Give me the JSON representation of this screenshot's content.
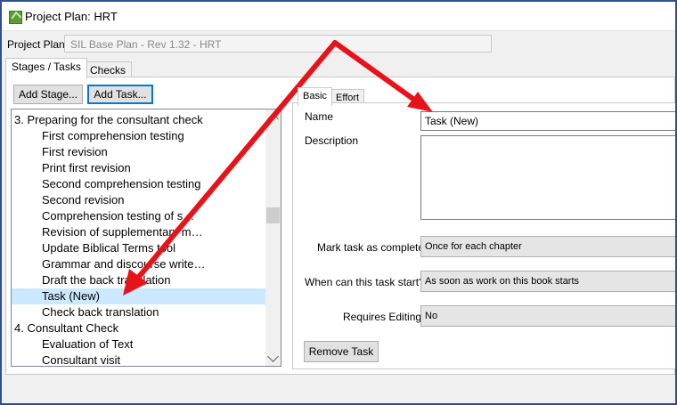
{
  "window": {
    "title": "Project Plan: HRT"
  },
  "project_plan": {
    "label": "Project Plan:",
    "value": "SIL Base Plan - Rev 1.32 - HRT"
  },
  "tabs": [
    {
      "label": "Stages / Tasks"
    },
    {
      "label": "Checks"
    }
  ],
  "toolbar": {
    "add_stage": "Add Stage...",
    "add_task": "Add Task..."
  },
  "tree": {
    "rows": [
      {
        "label": "3. Preparing for the consultant check",
        "level": 0
      },
      {
        "label": "First comprehension testing",
        "level": 1
      },
      {
        "label": "First revision",
        "level": 1
      },
      {
        "label": "Print first revision",
        "level": 1
      },
      {
        "label": "Second comprehension testing",
        "level": 1
      },
      {
        "label": "Second revision",
        "level": 1
      },
      {
        "label": "Comprehension testing of s…",
        "level": 1
      },
      {
        "label": "Revision of supplementary m…",
        "level": 1
      },
      {
        "label": "Update Biblical Terms tool",
        "level": 1
      },
      {
        "label": "Grammar and discourse write…",
        "level": 1
      },
      {
        "label": "Draft the back translation",
        "level": 1
      },
      {
        "label": "Task (New)",
        "level": 1,
        "selected": true
      },
      {
        "label": "Check back translation",
        "level": 1
      },
      {
        "label": "4. Consultant Check",
        "level": 0
      },
      {
        "label": "Evaluation of Text",
        "level": 1
      },
      {
        "label": "Consultant visit",
        "level": 1
      }
    ]
  },
  "detail": {
    "tabs": [
      {
        "label": "Basic"
      },
      {
        "label": "Effort"
      }
    ],
    "name_label": "Name",
    "name_value": "Task (New)",
    "description_label": "Description",
    "description_value": "",
    "mark_complete_label": "Mark task as complete",
    "mark_complete_value": "Once for each chapter",
    "start_label": "When can this task start?",
    "start_value": "As soon as work on this book starts",
    "requires_editing_label": "Requires Editing",
    "requires_editing_value": "No",
    "remove_task": "Remove Task"
  },
  "annotation": {
    "arrow_color": "#e8121b"
  }
}
